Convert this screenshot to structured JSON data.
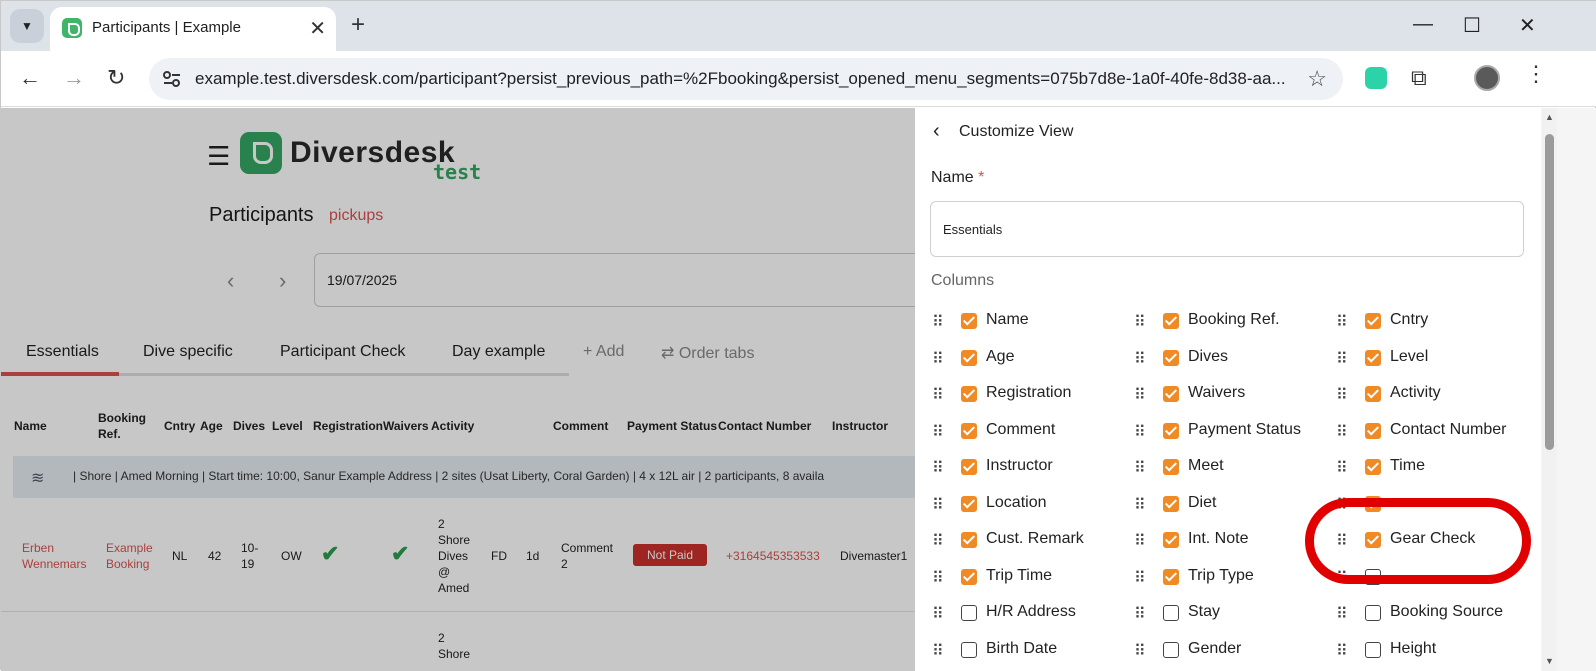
{
  "browser": {
    "tab_title": "Participants | Example",
    "url": "example.test.diversdesk.com/participant?persist_previous_path=%2Fbooking&persist_opened_menu_segments=075b7d8e-1a0f-40fe-8d38-aa..."
  },
  "app": {
    "logo_text": "Diversdesk",
    "logo_sub": "test",
    "page_title": "Participants",
    "page_subtitle": "pickups",
    "date": "19/07/2025",
    "tabs": [
      "Essentials",
      "Dive specific",
      "Participant Check",
      "Day example"
    ],
    "add_tab": "+ Add",
    "order_tabs": "⇄ Order tabs",
    "table_headers": {
      "name": "Name",
      "booking_ref_1": "Booking",
      "booking_ref_2": "Ref.",
      "cntry": "Cntry",
      "age": "Age",
      "dives": "Dives",
      "level": "Level",
      "registration": "Registration",
      "waivers": "Waivers",
      "activity": "Activity",
      "comment": "Comment",
      "payment": "Payment Status",
      "contact": "Contact Number",
      "instructor": "Instructor"
    },
    "summary": "|   Shore   |   Amed Morning   |   Start time: 10:00, Sanur Example Address   |   2 sites (Usat Liberty, Coral Garden)   |   4 x 12L air   |   2 participants, 8 availa",
    "row1": {
      "name_1": "Erben",
      "name_2": "Wennemars",
      "booking_1": "Example",
      "booking_2": "Booking",
      "cntry": "NL",
      "age": "42",
      "dives_1": "10-",
      "dives_2": "19",
      "level": "OW",
      "activity_1": "2",
      "activity_2": "Shore",
      "activity_3": "Dives",
      "activity_4": "@",
      "activity_5": "Amed",
      "fd": "FD",
      "dur": "1d",
      "comment_1": "Comment",
      "comment_2": "2",
      "payment": "Not Paid",
      "contact": "+3164545353533",
      "instructor": "Divemaster1"
    },
    "row2": {
      "activity_1": "2",
      "activity_2": "Shore"
    }
  },
  "panel": {
    "title": "Customize View",
    "name_label": "Name",
    "required_mark": "*",
    "name_value": "Essentials",
    "columns_label": "Columns",
    "col1": [
      "Name",
      "Age",
      "Registration",
      "Comment",
      "Instructor",
      "Location",
      "Cust. Remark",
      "Trip Time",
      "H/R Address",
      "Birth Date"
    ],
    "col2": [
      "Booking Ref.",
      "Dives",
      "Waivers",
      "Payment Status",
      "Meet",
      "Diet",
      "Int. Note",
      "Trip Type",
      "Stay",
      "Gender"
    ],
    "col3": [
      "Cntry",
      "Level",
      "Activity",
      "Contact Number",
      "Time",
      "",
      "Gear Check",
      "",
      "Booking Source",
      "Height"
    ],
    "checked": {
      "col1": [
        true,
        true,
        true,
        true,
        true,
        true,
        true,
        true,
        false,
        false
      ],
      "col2": [
        true,
        true,
        true,
        true,
        true,
        true,
        true,
        true,
        false,
        false
      ],
      "col3": [
        true,
        true,
        true,
        true,
        true,
        true,
        true,
        false,
        false,
        false
      ]
    }
  },
  "colors": {
    "accent": "#f08a24",
    "brand_green": "#35a765",
    "link_red": "#d9534f",
    "highlight_red": "#e00000"
  }
}
